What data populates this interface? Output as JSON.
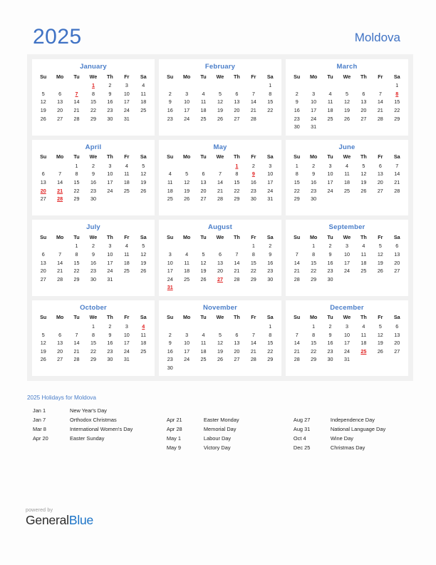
{
  "header": {
    "year": "2025",
    "country": "Moldova"
  },
  "weekday_headers": [
    "Su",
    "Mo",
    "Tu",
    "We",
    "Th",
    "Fr",
    "Sa"
  ],
  "months": [
    {
      "name": "January",
      "weeks": [
        [
          "",
          "",
          "",
          "1",
          "2",
          "3",
          "4"
        ],
        [
          "5",
          "6",
          "7",
          "8",
          "9",
          "10",
          "11"
        ],
        [
          "12",
          "13",
          "14",
          "15",
          "16",
          "17",
          "18"
        ],
        [
          "19",
          "20",
          "21",
          "22",
          "23",
          "24",
          "25"
        ],
        [
          "26",
          "27",
          "28",
          "29",
          "30",
          "31",
          ""
        ],
        [
          "",
          "",
          "",
          "",
          "",
          "",
          ""
        ]
      ],
      "holidays": [
        "1",
        "7"
      ]
    },
    {
      "name": "February",
      "weeks": [
        [
          "",
          "",
          "",
          "",
          "",
          "",
          "1"
        ],
        [
          "2",
          "3",
          "4",
          "5",
          "6",
          "7",
          "8"
        ],
        [
          "9",
          "10",
          "11",
          "12",
          "13",
          "14",
          "15"
        ],
        [
          "16",
          "17",
          "18",
          "19",
          "20",
          "21",
          "22"
        ],
        [
          "23",
          "24",
          "25",
          "26",
          "27",
          "28",
          ""
        ],
        [
          "",
          "",
          "",
          "",
          "",
          "",
          ""
        ]
      ],
      "holidays": []
    },
    {
      "name": "March",
      "weeks": [
        [
          "",
          "",
          "",
          "",
          "",
          "",
          "1"
        ],
        [
          "2",
          "3",
          "4",
          "5",
          "6",
          "7",
          "8"
        ],
        [
          "9",
          "10",
          "11",
          "12",
          "13",
          "14",
          "15"
        ],
        [
          "16",
          "17",
          "18",
          "19",
          "20",
          "21",
          "22"
        ],
        [
          "23",
          "24",
          "25",
          "26",
          "27",
          "28",
          "29"
        ],
        [
          "30",
          "31",
          "",
          "",
          "",
          "",
          ""
        ]
      ],
      "holidays": [
        "8"
      ]
    },
    {
      "name": "April",
      "weeks": [
        [
          "",
          "",
          "1",
          "2",
          "3",
          "4",
          "5"
        ],
        [
          "6",
          "7",
          "8",
          "9",
          "10",
          "11",
          "12"
        ],
        [
          "13",
          "14",
          "15",
          "16",
          "17",
          "18",
          "19"
        ],
        [
          "20",
          "21",
          "22",
          "23",
          "24",
          "25",
          "26"
        ],
        [
          "27",
          "28",
          "29",
          "30",
          "",
          "",
          ""
        ],
        [
          "",
          "",
          "",
          "",
          "",
          "",
          ""
        ]
      ],
      "holidays": [
        "20",
        "21",
        "28"
      ]
    },
    {
      "name": "May",
      "weeks": [
        [
          "",
          "",
          "",
          "",
          "1",
          "2",
          "3"
        ],
        [
          "4",
          "5",
          "6",
          "7",
          "8",
          "9",
          "10"
        ],
        [
          "11",
          "12",
          "13",
          "14",
          "15",
          "16",
          "17"
        ],
        [
          "18",
          "19",
          "20",
          "21",
          "22",
          "23",
          "24"
        ],
        [
          "25",
          "26",
          "27",
          "28",
          "29",
          "30",
          "31"
        ],
        [
          "",
          "",
          "",
          "",
          "",
          "",
          ""
        ]
      ],
      "holidays": [
        "1",
        "9"
      ]
    },
    {
      "name": "June",
      "weeks": [
        [
          "1",
          "2",
          "3",
          "4",
          "5",
          "6",
          "7"
        ],
        [
          "8",
          "9",
          "10",
          "11",
          "12",
          "13",
          "14"
        ],
        [
          "15",
          "16",
          "17",
          "18",
          "19",
          "20",
          "21"
        ],
        [
          "22",
          "23",
          "24",
          "25",
          "26",
          "27",
          "28"
        ],
        [
          "29",
          "30",
          "",
          "",
          "",
          "",
          ""
        ],
        [
          "",
          "",
          "",
          "",
          "",
          "",
          ""
        ]
      ],
      "holidays": []
    },
    {
      "name": "July",
      "weeks": [
        [
          "",
          "",
          "1",
          "2",
          "3",
          "4",
          "5"
        ],
        [
          "6",
          "7",
          "8",
          "9",
          "10",
          "11",
          "12"
        ],
        [
          "13",
          "14",
          "15",
          "16",
          "17",
          "18",
          "19"
        ],
        [
          "20",
          "21",
          "22",
          "23",
          "24",
          "25",
          "26"
        ],
        [
          "27",
          "28",
          "29",
          "30",
          "31",
          "",
          ""
        ],
        [
          "",
          "",
          "",
          "",
          "",
          "",
          ""
        ]
      ],
      "holidays": []
    },
    {
      "name": "August",
      "weeks": [
        [
          "",
          "",
          "",
          "",
          "",
          "1",
          "2"
        ],
        [
          "3",
          "4",
          "5",
          "6",
          "7",
          "8",
          "9"
        ],
        [
          "10",
          "11",
          "12",
          "13",
          "14",
          "15",
          "16"
        ],
        [
          "17",
          "18",
          "19",
          "20",
          "21",
          "22",
          "23"
        ],
        [
          "24",
          "25",
          "26",
          "27",
          "28",
          "29",
          "30"
        ],
        [
          "31",
          "",
          "",
          "",
          "",
          "",
          ""
        ]
      ],
      "holidays": [
        "27",
        "31"
      ]
    },
    {
      "name": "September",
      "weeks": [
        [
          "",
          "1",
          "2",
          "3",
          "4",
          "5",
          "6"
        ],
        [
          "7",
          "8",
          "9",
          "10",
          "11",
          "12",
          "13"
        ],
        [
          "14",
          "15",
          "16",
          "17",
          "18",
          "19",
          "20"
        ],
        [
          "21",
          "22",
          "23",
          "24",
          "25",
          "26",
          "27"
        ],
        [
          "28",
          "29",
          "30",
          "",
          "",
          "",
          ""
        ],
        [
          "",
          "",
          "",
          "",
          "",
          "",
          ""
        ]
      ],
      "holidays": []
    },
    {
      "name": "October",
      "weeks": [
        [
          "",
          "",
          "",
          "1",
          "2",
          "3",
          "4"
        ],
        [
          "5",
          "6",
          "7",
          "8",
          "9",
          "10",
          "11"
        ],
        [
          "12",
          "13",
          "14",
          "15",
          "16",
          "17",
          "18"
        ],
        [
          "19",
          "20",
          "21",
          "22",
          "23",
          "24",
          "25"
        ],
        [
          "26",
          "27",
          "28",
          "29",
          "30",
          "31",
          ""
        ],
        [
          "",
          "",
          "",
          "",
          "",
          "",
          ""
        ]
      ],
      "holidays": [
        "4"
      ]
    },
    {
      "name": "November",
      "weeks": [
        [
          "",
          "",
          "",
          "",
          "",
          "",
          "1"
        ],
        [
          "2",
          "3",
          "4",
          "5",
          "6",
          "7",
          "8"
        ],
        [
          "9",
          "10",
          "11",
          "12",
          "13",
          "14",
          "15"
        ],
        [
          "16",
          "17",
          "18",
          "19",
          "20",
          "21",
          "22"
        ],
        [
          "23",
          "24",
          "25",
          "26",
          "27",
          "28",
          "29"
        ],
        [
          "30",
          "",
          "",
          "",
          "",
          "",
          ""
        ]
      ],
      "holidays": []
    },
    {
      "name": "December",
      "weeks": [
        [
          "",
          "1",
          "2",
          "3",
          "4",
          "5",
          "6"
        ],
        [
          "7",
          "8",
          "9",
          "10",
          "11",
          "12",
          "13"
        ],
        [
          "14",
          "15",
          "16",
          "17",
          "18",
          "19",
          "20"
        ],
        [
          "21",
          "22",
          "23",
          "24",
          "25",
          "26",
          "27"
        ],
        [
          "28",
          "29",
          "30",
          "31",
          "",
          "",
          ""
        ],
        [
          "",
          "",
          "",
          "",
          "",
          "",
          ""
        ]
      ],
      "holidays": [
        "25"
      ]
    }
  ],
  "legend": {
    "title": "2025 Holidays for Moldova",
    "columns": [
      [
        {
          "date": "Jan 1",
          "name": "New Year's Day"
        },
        {
          "date": "Jan 7",
          "name": "Orthodox Christmas"
        },
        {
          "date": "Mar 8",
          "name": "International Women's Day"
        },
        {
          "date": "Apr 20",
          "name": "Easter Sunday"
        }
      ],
      [
        {
          "date": "Apr 21",
          "name": "Easter Monday"
        },
        {
          "date": "Apr 28",
          "name": "Memorial Day"
        },
        {
          "date": "May 1",
          "name": "Labour Day"
        },
        {
          "date": "May 9",
          "name": "Victory Day"
        }
      ],
      [
        {
          "date": "Aug 27",
          "name": "Independence Day"
        },
        {
          "date": "Aug 31",
          "name": "National Language Day"
        },
        {
          "date": "Oct 4",
          "name": "Wine Day"
        },
        {
          "date": "Dec 25",
          "name": "Christmas Day"
        }
      ]
    ]
  },
  "footer": {
    "powered_by": "powered by",
    "brand_first": "General",
    "brand_second": "Blue"
  },
  "colors": {
    "accent_blue": "#4a7ec9",
    "title_blue": "#3f72c4",
    "holiday_red": "#e02020",
    "panel_gray": "#f1f1f1",
    "brand_blue": "#1a73c7"
  }
}
